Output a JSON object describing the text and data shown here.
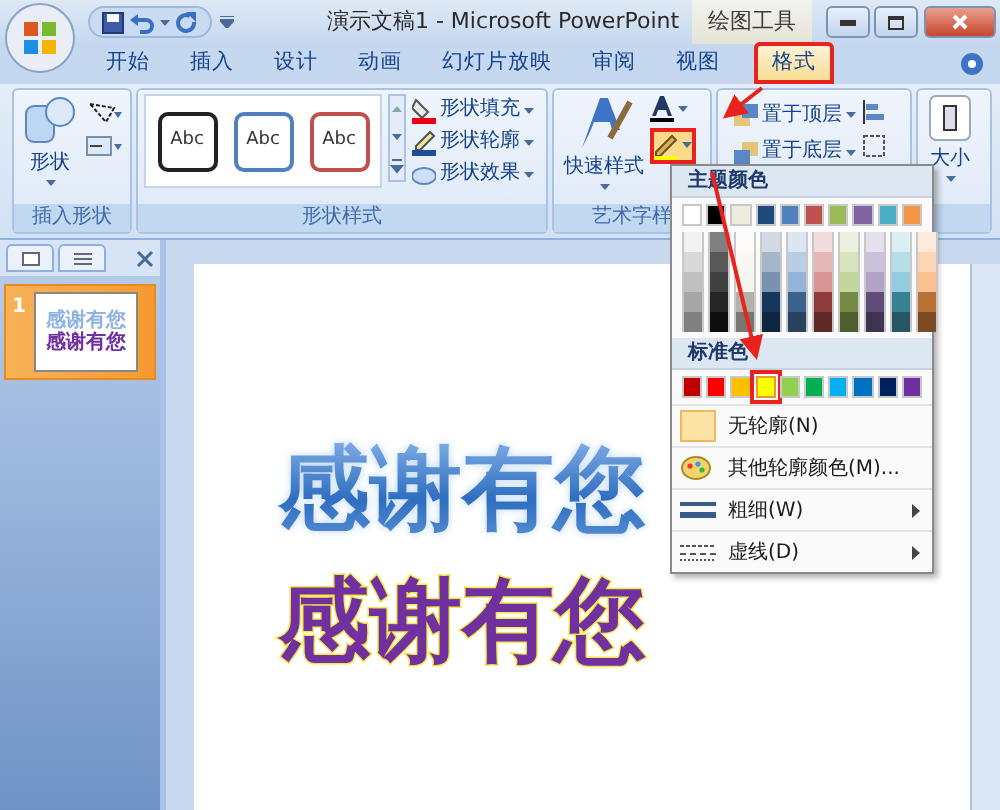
{
  "window": {
    "title": "演示文稿1 - Microsoft PowerPoint",
    "context_tab": "绘图工具"
  },
  "tabs": [
    {
      "label": "开始",
      "selected": false,
      "highlighted": false
    },
    {
      "label": "插入",
      "selected": false,
      "highlighted": false
    },
    {
      "label": "设计",
      "selected": false,
      "highlighted": false
    },
    {
      "label": "动画",
      "selected": false,
      "highlighted": false
    },
    {
      "label": "幻灯片放映",
      "selected": false,
      "highlighted": false
    },
    {
      "label": "审阅",
      "selected": false,
      "highlighted": false
    },
    {
      "label": "视图",
      "selected": false,
      "highlighted": false
    },
    {
      "label": "格式",
      "selected": true,
      "highlighted": true
    }
  ],
  "ribbon": {
    "insert_shapes": {
      "title": "插入形状",
      "button": "形状"
    },
    "shape_styles": {
      "title": "形状样式",
      "gallery": [
        {
          "label": "Abc",
          "color": "#222222"
        },
        {
          "label": "Abc",
          "color": "#4f81bd"
        },
        {
          "label": "Abc",
          "color": "#c0504d"
        }
      ],
      "commands": [
        "形状填充",
        "形状轮廓",
        "形状效果"
      ]
    },
    "wordart_styles": {
      "title": "艺术字样",
      "button": "快速样式",
      "outline_button_highlighted": true
    },
    "arrange": {
      "commands": [
        "置于顶层",
        "置于底层"
      ]
    },
    "size": {
      "button": "大小"
    }
  },
  "slide_panel": {
    "slides": [
      {
        "number": "1",
        "selected": true,
        "lines": [
          "感谢有您",
          "感谢有您"
        ]
      }
    ]
  },
  "slide": {
    "texts": [
      {
        "text": "感谢有您",
        "kind": "gradient"
      },
      {
        "text": "感谢有您",
        "kind": "outlined"
      }
    ]
  },
  "outline_menu": {
    "theme_header": "主题颜色",
    "theme_colors": [
      {
        "color": "#ffffff"
      },
      {
        "color": "#000000"
      },
      {
        "color": "#eeece1"
      },
      {
        "color": "#1f497d"
      },
      {
        "color": "#4f81bd"
      },
      {
        "color": "#c0504d"
      },
      {
        "color": "#9bbb59"
      },
      {
        "color": "#8064a2"
      },
      {
        "color": "#4bacc6"
      },
      {
        "color": "#f79646"
      }
    ],
    "standard_header": "标准色",
    "standard_colors": [
      {
        "color": "#c00000",
        "selected": false
      },
      {
        "color": "#ff0000",
        "selected": false
      },
      {
        "color": "#ffc000",
        "selected": false
      },
      {
        "color": "#ffff00",
        "selected": true
      },
      {
        "color": "#92d050",
        "selected": false
      },
      {
        "color": "#00b050",
        "selected": false
      },
      {
        "color": "#00b0f0",
        "selected": false
      },
      {
        "color": "#0070c0",
        "selected": false
      },
      {
        "color": "#002060",
        "selected": false
      },
      {
        "color": "#7030a0",
        "selected": false
      }
    ],
    "items": [
      {
        "label": "无轮廓(N)",
        "kind": "none",
        "submenu": false
      },
      {
        "label": "其他轮廓颜色(M)...",
        "kind": "palette",
        "submenu": false
      },
      {
        "label": "粗细(W)",
        "kind": "weight",
        "submenu": true
      },
      {
        "label": "虚线(D)",
        "kind": "dash",
        "submenu": true
      }
    ]
  }
}
